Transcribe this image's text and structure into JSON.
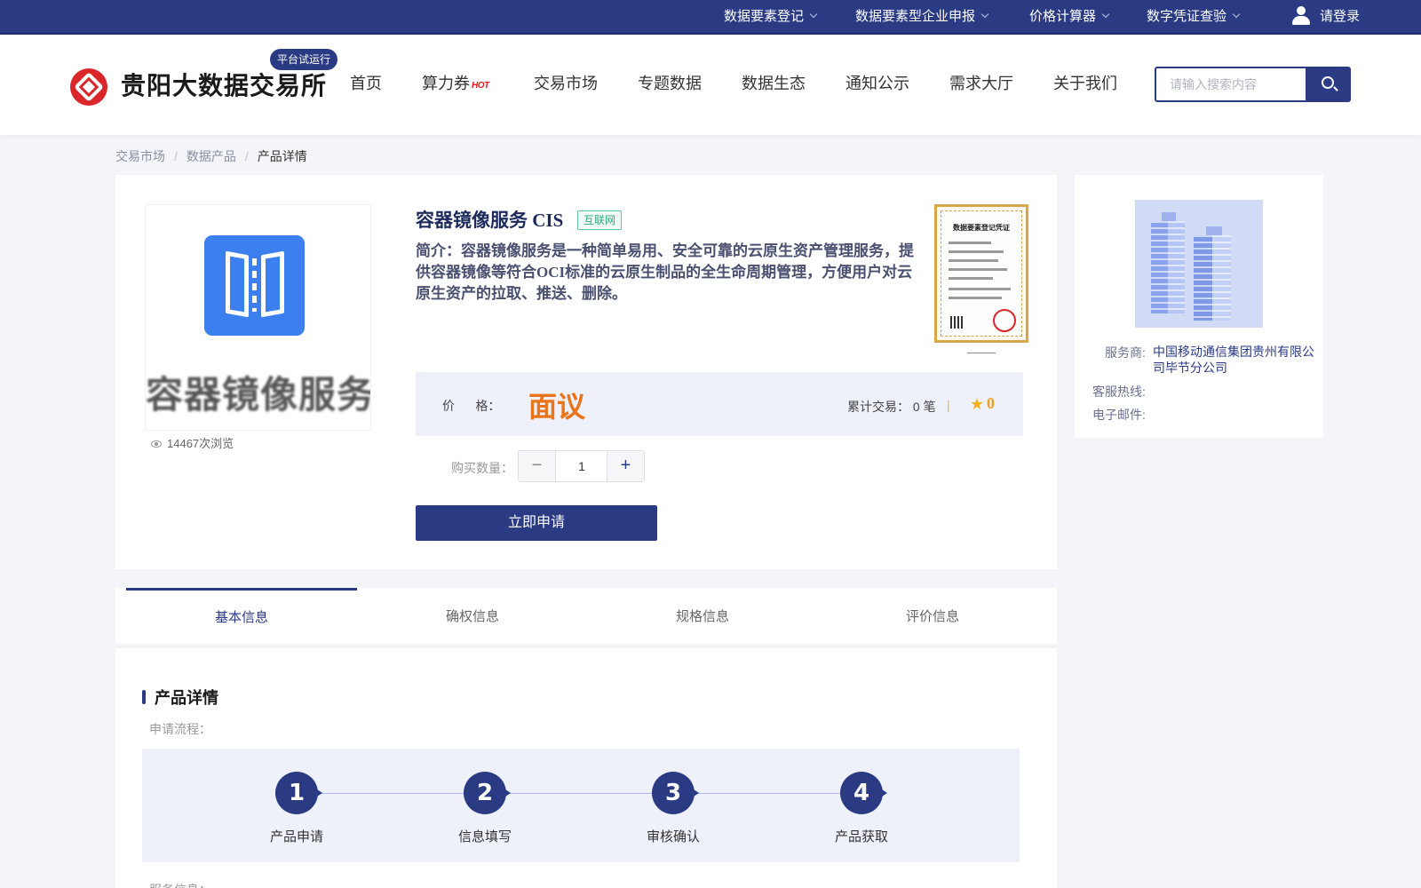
{
  "topbar": {
    "items": [
      {
        "label": "数据要素登记"
      },
      {
        "label": "数据要素型企业申报"
      },
      {
        "label": "价格计算器"
      },
      {
        "label": "数字凭证查验"
      }
    ],
    "login_label": "请登录"
  },
  "header": {
    "logo_text": "贵阳大数据交易所",
    "trial_badge": "平台试运行",
    "nav": [
      {
        "label": "首页"
      },
      {
        "label": "算力券",
        "badge": "HOT"
      },
      {
        "label": "交易市场"
      },
      {
        "label": "专题数据"
      },
      {
        "label": "数据生态"
      },
      {
        "label": "通知公示"
      },
      {
        "label": "需求大厅"
      },
      {
        "label": "关于我们"
      }
    ],
    "search_placeholder": "请输入搜索内容"
  },
  "breadcrumb": {
    "items": [
      "交易市场",
      "数据产品",
      "产品详情"
    ]
  },
  "product": {
    "image_text": "容器镜像服务",
    "views": "14467次浏览",
    "title": "容器镜像服务 CIS",
    "tag": "互联网",
    "description": "简介：容器镜像服务是一种简单易用、安全可靠的云原生资产管理服务，提供容器镜像等符合OCI标准的云原生制品的全生命周期管理，方便用户对云原生资产的拉取、推送、删除。",
    "certificate_title": "数据要素登记凭证",
    "price_label": "价      格：",
    "price_value": "面议",
    "trade_count": "累计交易： 0 笔",
    "divider": "|",
    "rating_count": "0",
    "quantity_label": "购买数量：",
    "quantity_value": "1",
    "apply_button": "立即申请"
  },
  "provider": {
    "service_label": "服务商:",
    "service_value": "中国移动通信集团贵州有限公司毕节分公司",
    "hotline_label": "客服热线:",
    "email_label": "电子邮件:"
  },
  "tabs": [
    {
      "label": "基本信息"
    },
    {
      "label": "确权信息"
    },
    {
      "label": "规格信息"
    },
    {
      "label": "评价信息"
    }
  ],
  "detail": {
    "section_title": "产品详情",
    "flow_label": "申请流程：",
    "steps": [
      {
        "num": "1",
        "label": "产品申请"
      },
      {
        "num": "2",
        "label": "信息填写"
      },
      {
        "num": "3",
        "label": "审核确认"
      },
      {
        "num": "4",
        "label": "产品获取"
      }
    ],
    "service_info_label": "服务信息："
  },
  "colors": {
    "primary": "#2a3b83",
    "price": "#e8741c",
    "logo_red": "#d9262b",
    "tag_green": "#2eaa7c"
  },
  "icons": [
    "chevron-down-icon",
    "user-icon",
    "logo-icon",
    "search-icon",
    "eye-icon",
    "star-icon",
    "minus-icon",
    "plus-icon",
    "building-illustration"
  ]
}
